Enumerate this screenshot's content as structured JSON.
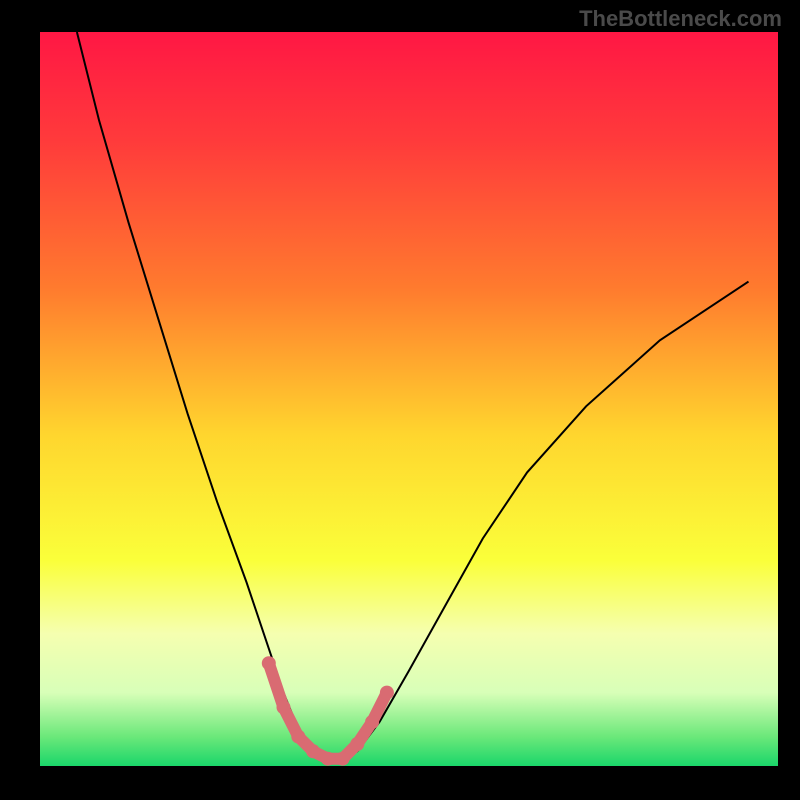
{
  "watermark": "TheBottleneck.com",
  "chart_data": {
    "type": "line",
    "title": "",
    "xlabel": "",
    "ylabel": "",
    "xlim": [
      0,
      100
    ],
    "ylim": [
      0,
      100
    ],
    "background": {
      "type": "vertical-gradient",
      "stops": [
        {
          "offset": 0,
          "color": "#ff1744"
        },
        {
          "offset": 0.15,
          "color": "#ff3b3b"
        },
        {
          "offset": 0.35,
          "color": "#ff7b2e"
        },
        {
          "offset": 0.55,
          "color": "#ffd62e"
        },
        {
          "offset": 0.72,
          "color": "#faff3a"
        },
        {
          "offset": 0.82,
          "color": "#f5ffb0"
        },
        {
          "offset": 0.9,
          "color": "#d8ffb8"
        },
        {
          "offset": 0.96,
          "color": "#6be87a"
        },
        {
          "offset": 1.0,
          "color": "#1ad66a"
        }
      ]
    },
    "series": [
      {
        "name": "bottleneck-curve",
        "color": "#000000",
        "x": [
          5,
          8,
          12,
          16,
          20,
          24,
          28,
          31,
          33,
          35,
          37,
          39,
          41,
          43,
          46,
          50,
          55,
          60,
          66,
          74,
          84,
          96
        ],
        "y": [
          100,
          88,
          74,
          61,
          48,
          36,
          25,
          16,
          10,
          5,
          2,
          1,
          1,
          2,
          6,
          13,
          22,
          31,
          40,
          49,
          58,
          66
        ]
      }
    ],
    "highlight": {
      "name": "minimum-region",
      "color": "#d96b72",
      "thickness": 12,
      "x": [
        31,
        33,
        35,
        37,
        39,
        41,
        43,
        45,
        47
      ],
      "y": [
        14,
        8,
        4,
        2,
        1,
        1,
        3,
        6,
        10
      ]
    }
  }
}
